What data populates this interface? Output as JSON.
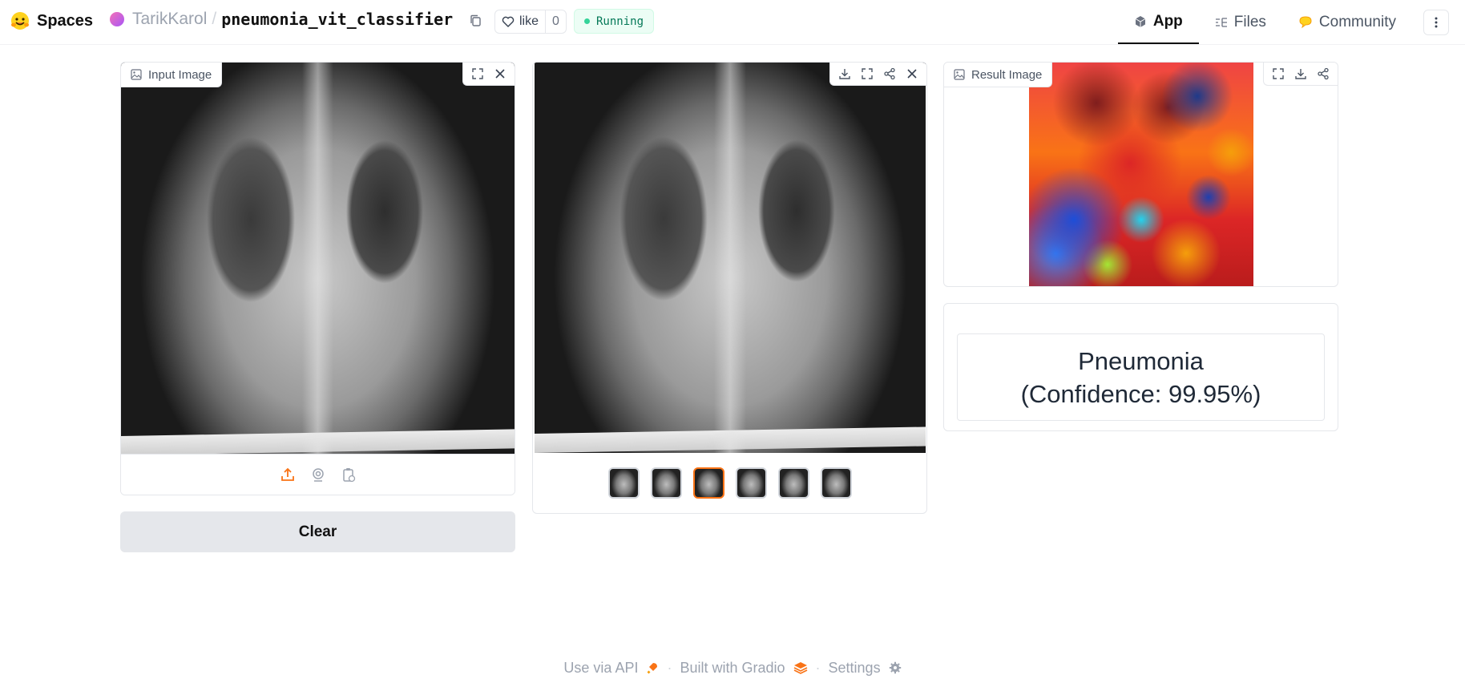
{
  "header": {
    "brand": "Spaces",
    "owner": "TarikKarol",
    "separator": "/",
    "repo": "pneumonia_vit_classifier",
    "like_label": "like",
    "like_count": "0",
    "status": "Running",
    "nav": [
      {
        "label": "App",
        "icon": "cube-icon",
        "active": true
      },
      {
        "label": "Files",
        "icon": "files-icon",
        "active": false
      },
      {
        "label": "Community",
        "icon": "community-icon",
        "active": false
      }
    ]
  },
  "input_panel": {
    "label": "Input Image",
    "clear_label": "Clear"
  },
  "examples_panel": {
    "thumbnail_count": 6,
    "selected_index": 2
  },
  "result_panel": {
    "label": "Result Image"
  },
  "prediction": {
    "text": "Pneumonia (Confidence: 99.95%)"
  },
  "footer": {
    "api": "Use via API",
    "gradio": "Built with Gradio",
    "settings": "Settings",
    "dot": "·"
  },
  "colors": {
    "accent": "#f97316",
    "running_text": "#047857",
    "running_bg": "#ecfdf5"
  }
}
